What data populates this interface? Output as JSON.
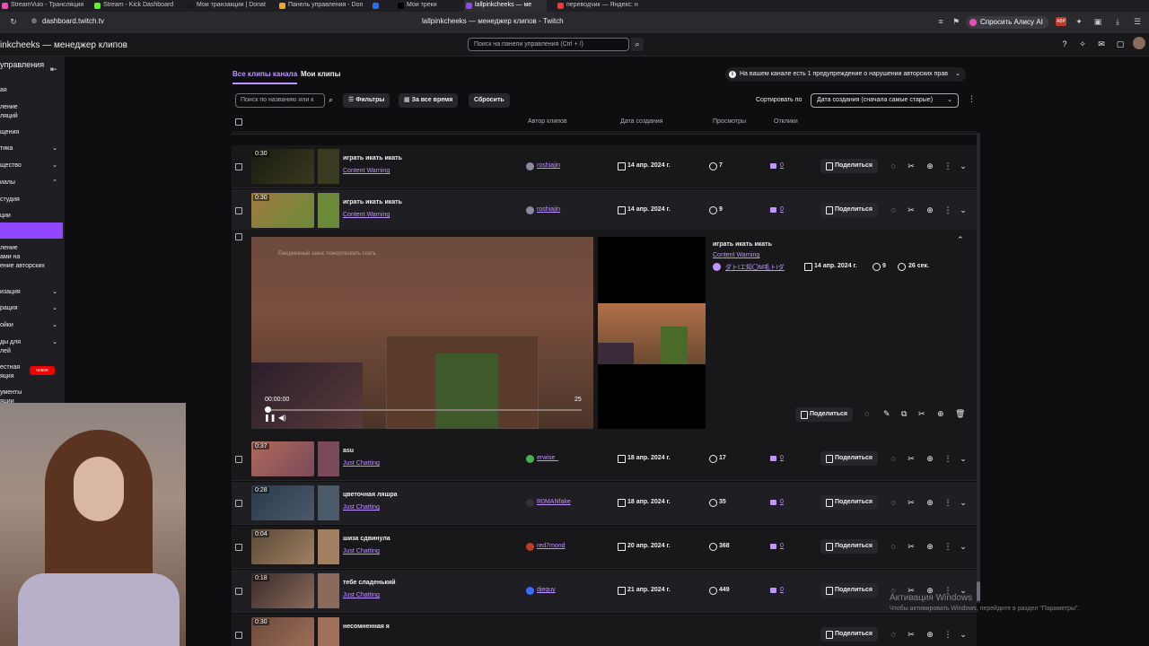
{
  "browser": {
    "tabs": [
      {
        "label": "StreamVuio - Трансляция",
        "color": "#e84fb0"
      },
      {
        "label": "Stream - Kick Dashboard",
        "color": "#53fc18"
      },
      {
        "label": "Мои транзакции | Donat",
        "color": "#1a1a1a"
      },
      {
        "label": "Панель управления - Don",
        "color": "#f5a623"
      },
      {
        "label": "",
        "color": "#1e6fff"
      },
      {
        "label": "Мои треки",
        "color": "#000000"
      },
      {
        "label": "lallpinkcheeks — ме",
        "color": "#9147ff"
      },
      {
        "label": "переводчик — Яндекс: н",
        "color": "#ff3333"
      }
    ],
    "url": "dashboard.twitch.tv",
    "page_title": "lallpinkcheeks — менеджер клипов - Twitch",
    "alice_label": "Спросить Алису AI"
  },
  "header": {
    "title": "inkcheeks — менеджер клипов",
    "search_placeholder": "Поиск на панели управления (Ctrl + /)"
  },
  "sidebar": {
    "heading": "управления",
    "items": [
      {
        "label": "ая",
        "chev": ""
      },
      {
        "label": "ление",
        "chev": ""
      },
      {
        "label": "ляций",
        "chev": ""
      },
      {
        "label": "щения",
        "chev": ""
      },
      {
        "label": "тика",
        "chev": "⌄"
      },
      {
        "label": "щество",
        "chev": "⌄"
      },
      {
        "label": "иалы",
        "chev": "⌃"
      },
      {
        "label": "студия",
        "chev": ""
      },
      {
        "label": "ции",
        "chev": ""
      },
      {
        "label": "ление",
        "chev": ""
      },
      {
        "label": "ами на",
        "chev": ""
      },
      {
        "label": "ение авторских",
        "chev": ""
      },
      {
        "label": "изация",
        "chev": "⌄"
      },
      {
        "label": "рация",
        "chev": "⌄"
      },
      {
        "label": "ойки",
        "chev": "⌄"
      },
      {
        "label": "ды для",
        "chev": "⌄"
      },
      {
        "label": "лей",
        "chev": ""
      },
      {
        "label": "естная",
        "chev": ""
      },
      {
        "label": "яция",
        "chev": ""
      },
      {
        "label": "ументы",
        "chev": ""
      },
      {
        "label": "яции",
        "chev": ""
      }
    ],
    "new_badge": "новое"
  },
  "main": {
    "tabs": [
      "Все клипы канала",
      "Мои клипы"
    ],
    "warning": "На вашем канале есть 1 предупреждение о нарушении авторских прав",
    "search_placeholder": "Поиск по названию или к",
    "filters": "Фильтры",
    "time_range": "За все время",
    "reset": "Сбросить",
    "sort_label": "Сортировать по",
    "sort_value": "Дата создания (сначала самые старые)",
    "columns": [
      "Автор клипов",
      "Дата создания",
      "Просмотры",
      "Отклики"
    ],
    "share_label": "Поделиться"
  },
  "clips": [
    {
      "duration": "0:30",
      "title": "играть икать икать",
      "category": "Content Warning",
      "author": "roshiajin",
      "author_color": "#8a8aa0",
      "date": "14 апр. 2024 г.",
      "views": "7",
      "reactions": "0",
      "thumb": [
        "#1a1a10",
        "#3a3a20"
      ]
    },
    {
      "duration": "0:30",
      "title": "играть икать икать",
      "category": "Content Warning",
      "author": "roshiajin",
      "author_color": "#8a8aa0",
      "date": "14 апр. 2024 г.",
      "views": "9",
      "reactions": "0",
      "thumb": [
        "#a07a40",
        "#6a8a3a"
      ]
    },
    {
      "duration": "0:37",
      "title": "asu",
      "category": "Just Chatting",
      "author": "erwise_",
      "author_color": "#4caf50",
      "date": "18 апр. 2024 г.",
      "views": "17",
      "reactions": "0",
      "thumb": [
        "#b06a5a",
        "#7a4a5a"
      ]
    },
    {
      "duration": "0:28",
      "title": "цветочная ляшра",
      "category": "Just Chatting",
      "author": "R0MANfake",
      "author_color": "#333333",
      "date": "18 апр. 2024 г.",
      "views": "35",
      "reactions": "0",
      "thumb": [
        "#2a3a4a",
        "#4a5a6a"
      ]
    },
    {
      "duration": "0:04",
      "title": "шиза сдвинула",
      "category": "Just Chatting",
      "author": "red7mond",
      "author_color": "#c0392b",
      "date": "20 апр. 2024 г.",
      "views": "368",
      "reactions": "0",
      "thumb": [
        "#5a4a3a",
        "#a08060"
      ]
    },
    {
      "duration": "0:18",
      "title": "тебе сладенький",
      "category": "Just Chatting",
      "author": "djeguy",
      "author_color": "#3a6aff",
      "date": "21 апр. 2024 г.",
      "views": "449",
      "reactions": "0",
      "thumb": [
        "#3a2a2a",
        "#8a6a5a"
      ]
    },
    {
      "duration": "0:30",
      "title": "несомненная я",
      "category": "",
      "author": "",
      "author_color": "#555555",
      "date": "",
      "views": "",
      "reactions": "",
      "thumb": [
        "#6a4a3a",
        "#a0705a"
      ]
    }
  ],
  "expanded": {
    "title": "играть икать икать",
    "category": "Content Warning",
    "author": "ダトIエ知〇M毛トIダ",
    "date": "14 апр. 2024 г.",
    "views": "9",
    "length": "26 сек.",
    "current_time": "00:00:00",
    "end_time": "25",
    "overlay_text": "Ежедневный шанс пожертвовать спать",
    "share_label": "Поделиться"
  },
  "watermark": {
    "line1": "Активация Windows",
    "line2": "Чтобы активировать Windows, перейдите в раздел \"Параметры\"."
  }
}
